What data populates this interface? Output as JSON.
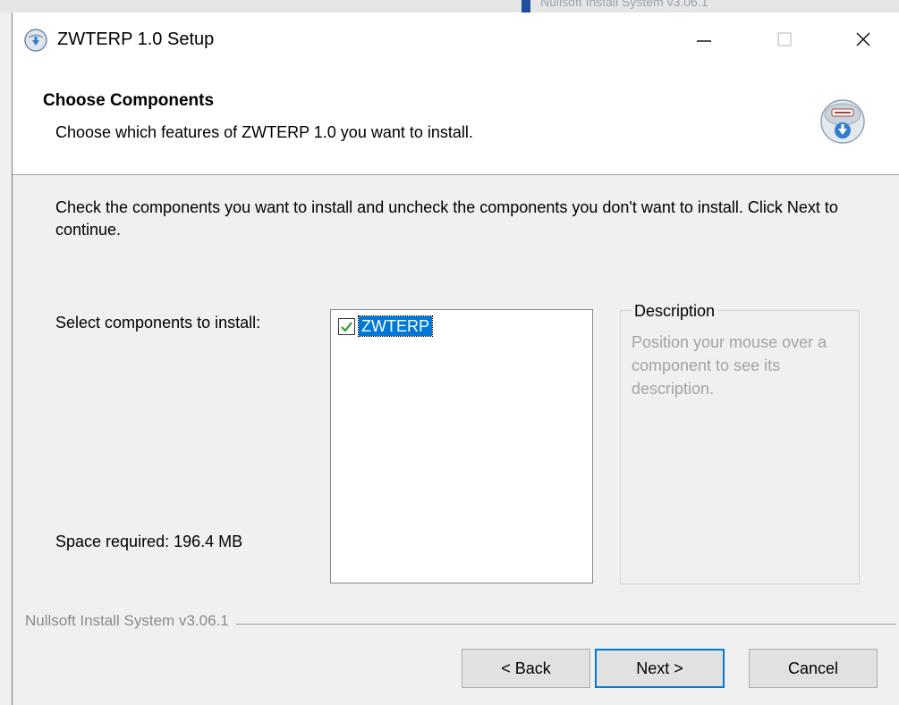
{
  "background": {
    "partial_text": "Nullsoft Install System v3.06.1"
  },
  "window": {
    "title": "ZWTERP 1.0 Setup",
    "controls": {
      "minimize": "minimize-icon",
      "maximize": "maximize-icon",
      "close": "close-icon"
    }
  },
  "header": {
    "title": "Choose Components",
    "subtitle": "Choose which features of ZWTERP 1.0 you want to install.",
    "icon": "nsis-installer-icon"
  },
  "body": {
    "intro": "Check the components you want to install and uncheck the components you don't want to install. Click Next to continue.",
    "select_label": "Select components to install:",
    "space_label": "Space required: 196.4 MB"
  },
  "components": [
    {
      "label": "ZWTERP",
      "checked": true
    }
  ],
  "description": {
    "title": "Description",
    "text": "Position your mouse over a component to see its description."
  },
  "branding": "Nullsoft Install System v3.06.1",
  "buttons": {
    "back": "< Back",
    "next": "Next >",
    "cancel": "Cancel"
  },
  "colors": {
    "accent": "#0078d7",
    "check": "#2a9d2a"
  }
}
